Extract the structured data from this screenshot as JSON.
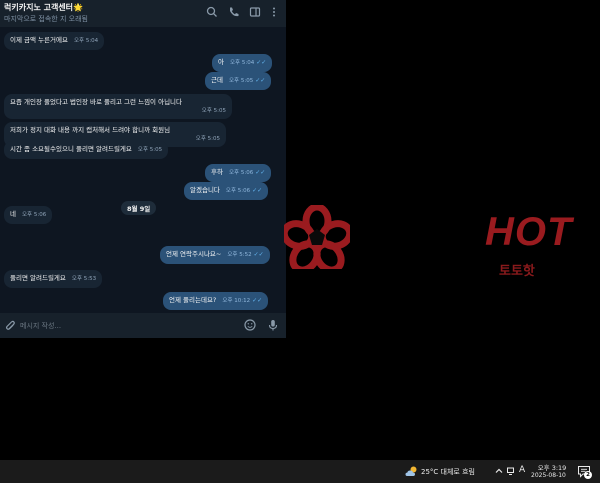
{
  "chat": {
    "title": "럭키카지노 고객센터",
    "title_emoji": "🌟",
    "status": "마지막으로 접속한 지 오래됨",
    "input_placeholder": "메시지 작성...",
    "messages": [
      {
        "dir": "in",
        "text": "이제 금액 누른거에요",
        "time": "오후 5:04"
      },
      {
        "dir": "out",
        "text": "아",
        "time": "오후 5:04"
      },
      {
        "dir": "out",
        "text": "근데",
        "time": "오후 5:05"
      },
      {
        "dir": "in",
        "text": "요즘 개인장 풀었다고 법인장 바로 풀리고 그런 느낌이 아닙니다",
        "time": "오후 5:05"
      },
      {
        "dir": "in",
        "text": "저희가 정지 대화 내용 까지 캡처해서 드려야 합니까 회원님",
        "time": "오후 5:05"
      },
      {
        "dir": "in",
        "text": "시간 좀 소요될수있으니 풀리면 알려드릴게요",
        "time": "오후 5:05"
      },
      {
        "dir": "out",
        "text": "후하",
        "time": "오후 5:06"
      },
      {
        "dir": "out",
        "text": "알겠습니다",
        "time": "오후 5:06"
      },
      {
        "dir": "in",
        "text": "네",
        "time": "오후 5:06"
      },
      {
        "dir": "out",
        "text": "언제 연락주시나요~",
        "time": "오후 5:52"
      },
      {
        "dir": "in",
        "text": "풀리면 알려드릴게요",
        "time": "오후 5:53"
      },
      {
        "dir": "out",
        "text": "언제 풀리는데요?",
        "time": "오후 10:12"
      }
    ],
    "date_separator": "8월 9일"
  },
  "watermark": {
    "brand": "HOT",
    "subtitle": "토토핫",
    "color": "#9a1b1f"
  },
  "taskbar": {
    "weather": "25°C  대체로 흐림",
    "ime": "A",
    "time": "오후 3:19",
    "date": "2025-08-10",
    "notification_count": "2"
  },
  "colors": {
    "chat_bg": "#0e1621",
    "header_bg": "#17212b",
    "bubble_in": "#182533",
    "bubble_out": "#2b5278",
    "tick": "#64b5ef"
  }
}
